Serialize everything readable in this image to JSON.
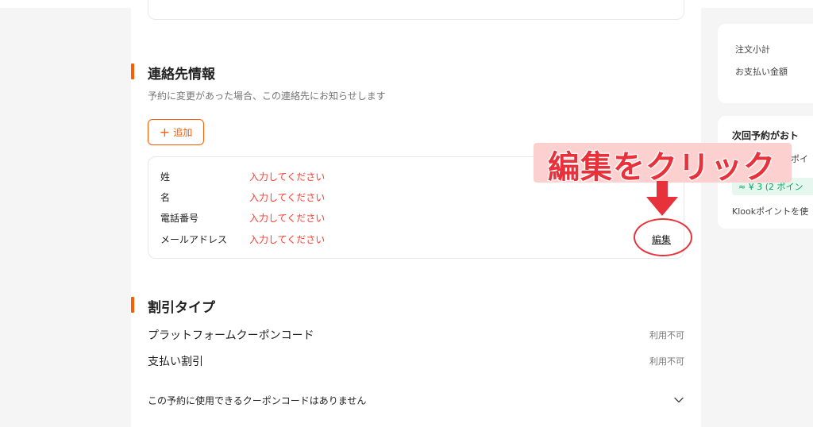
{
  "contact_section": {
    "title": "連絡先情報",
    "description": "予約に変更があった場合、この連絡先にお知らせします",
    "add_button": "追加",
    "fields": [
      {
        "label": "姓",
        "value": "入力してください"
      },
      {
        "label": "名",
        "value": "入力してください"
      },
      {
        "label": "電話番号",
        "value": "入力してください"
      },
      {
        "label": "メールアドレス",
        "value": "入力してください"
      }
    ],
    "edit_label": "編集"
  },
  "discount_section": {
    "title": "割引タイプ",
    "rows": [
      {
        "label": "プラットフォームクーポンコード",
        "status": "利用不可"
      },
      {
        "label": "支払い割引",
        "status": "利用不可"
      }
    ],
    "coupon_note": "この予約に使用できるクーポンコードはありません"
  },
  "sidebar": {
    "summary": {
      "subtotal_label": "注文小計",
      "total_label": "お支払い金額"
    },
    "points": {
      "title": "次回予約がおト",
      "points_label_partial": "ポイ",
      "badge": "≈ ¥ 3 (2 ポイン",
      "note": "Klookポイントを使"
    }
  },
  "annotation": {
    "text": "編集をクリック"
  },
  "colors": {
    "accent": "#ff5b00",
    "required_text": "#ff3b30",
    "annotation": "#e8323b",
    "points_green": "#00a862"
  }
}
